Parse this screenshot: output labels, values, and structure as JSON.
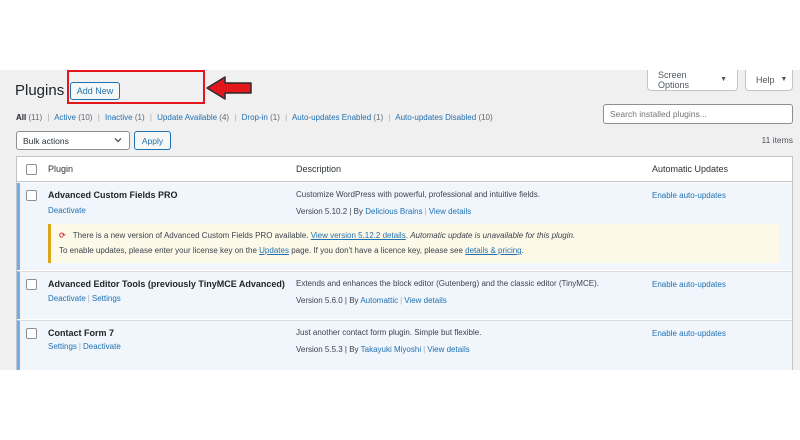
{
  "page": {
    "title": "Plugins",
    "add_new_label": "Add New"
  },
  "top_tabs": {
    "screen_options": "Screen Options",
    "help": "Help",
    "caret": "▼"
  },
  "filters": {
    "all": "All",
    "all_count": "(11)",
    "items": [
      {
        "label": "Active",
        "count": "(10)"
      },
      {
        "label": "Inactive",
        "count": "(1)"
      },
      {
        "label": "Update Available",
        "count": "(4)"
      },
      {
        "label": "Drop-in",
        "count": "(1)"
      },
      {
        "label": "Auto-updates Enabled",
        "count": "(1)"
      },
      {
        "label": "Auto-updates Disabled",
        "count": "(10)"
      }
    ],
    "separator": "|"
  },
  "search": {
    "placeholder": "Search installed plugins..."
  },
  "bulk": {
    "selected": "Bulk actions",
    "apply_label": "Apply"
  },
  "items_count": "11 items",
  "table": {
    "headers": {
      "plugin": "Plugin",
      "description": "Description",
      "auto": "Automatic Updates"
    },
    "rows": [
      {
        "name": "Advanced Custom Fields PRO",
        "links": [
          "Deactivate"
        ],
        "description": "Customize WordPress with powerful, professional and intuitive fields.",
        "version_prefix": "Version 5.10.2 | By",
        "author": "Delicious Brains",
        "details": "View details",
        "auto": "Enable auto-updates",
        "notice": {
          "icon": "⟳",
          "text1": "There is a new version of Advanced Custom Fields PRO available.",
          "link1": "View version 5.12.2 details",
          "text1_em": "Automatic update is unavailable for this plugin.",
          "text2a": "To enable updates, please enter your license key on the",
          "link2": "Updates",
          "text2b": "page. If you don't have a licence key, please see",
          "link3": "details & pricing",
          "text2c": "."
        }
      },
      {
        "name": "Advanced Editor Tools (previously TinyMCE Advanced)",
        "links": [
          "Deactivate",
          "Settings"
        ],
        "description": "Extends and enhances the block editor (Gutenberg) and the classic editor (TinyMCE).",
        "version_prefix": "Version 5.6.0 | By",
        "author": "Automattic",
        "details": "View details",
        "auto": "Enable auto-updates"
      },
      {
        "name": "Contact Form 7",
        "links": [
          "Settings",
          "Deactivate"
        ],
        "description": "Just another contact form plugin. Simple but flexible.",
        "version_prefix": "Version 5.5.3 | By",
        "author": "Takayuki Miyoshi",
        "details": "View details",
        "auto": "Enable auto-updates"
      }
    ]
  },
  "colors": {
    "highlight": "#e3161c",
    "link": "#2271b1",
    "active_border": "#72aee6",
    "notice_border": "#dba617"
  },
  "icons": [
    "chevron-down-icon",
    "update-icon",
    "red-arrow-icon"
  ]
}
